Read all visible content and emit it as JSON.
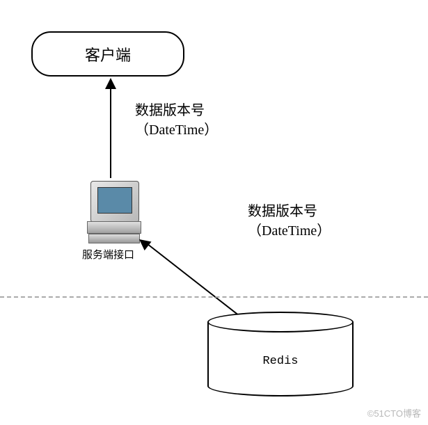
{
  "nodes": {
    "client": {
      "label": "客户端"
    },
    "server": {
      "label": "服务端接口"
    },
    "database": {
      "label": "Redis"
    }
  },
  "edges": {
    "server_to_client": {
      "label_line1": "数据版本号",
      "label_line2": "（DateTime）"
    },
    "database_to_server": {
      "label_line1": "数据版本号",
      "label_line2": "（DateTime）"
    }
  },
  "watermark": "©51CTO博客"
}
